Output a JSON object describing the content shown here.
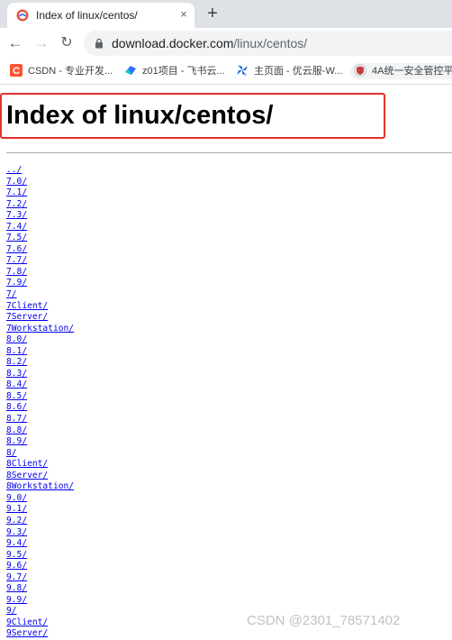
{
  "browser": {
    "tab_title": "Index of linux/centos/",
    "close_glyph": "×",
    "new_tab_glyph": "+",
    "url_host": "download.docker.com",
    "url_path": "/linux/centos/",
    "back_glyph": "←",
    "forward_glyph": "→",
    "reload_glyph": "↻"
  },
  "bookmarks": [
    {
      "label": "CSDN - 专业开发...",
      "icon": "csdn-icon",
      "color": "#fc5531"
    },
    {
      "label": "z01项目 - 飞书云...",
      "icon": "feishu-icon",
      "color": "#3370ff"
    },
    {
      "label": "主页面 - 优云服-W...",
      "icon": "pinwheel-icon",
      "color": "#1e6fd9"
    },
    {
      "label": "4A统一安全管控平",
      "icon": "shield-icon",
      "color": "#c43c3c"
    }
  ],
  "page": {
    "heading": "Index of linux/centos/",
    "entries": [
      "../",
      "7.0/",
      "7.1/",
      "7.2/",
      "7.3/",
      "7.4/",
      "7.5/",
      "7.6/",
      "7.7/",
      "7.8/",
      "7.9/",
      "7/",
      "7Client/",
      "7Server/",
      "7Workstation/",
      "8.0/",
      "8.1/",
      "8.2/",
      "8.3/",
      "8.4/",
      "8.5/",
      "8.6/",
      "8.7/",
      "8.8/",
      "8.9/",
      "8/",
      "8Client/",
      "8Server/",
      "8Workstation/",
      "9.0/",
      "9.1/",
      "9.2/",
      "9.3/",
      "9.4/",
      "9.5/",
      "9.6/",
      "9.7/",
      "9.8/",
      "9.9/",
      "9/",
      "9Client/",
      "9Server/"
    ]
  },
  "watermark": "CSDN @2301_78571402",
  "colors": {
    "link": "#0000ee",
    "highlight_box": "#e5302d",
    "tabstrip": "#dee1e6"
  }
}
